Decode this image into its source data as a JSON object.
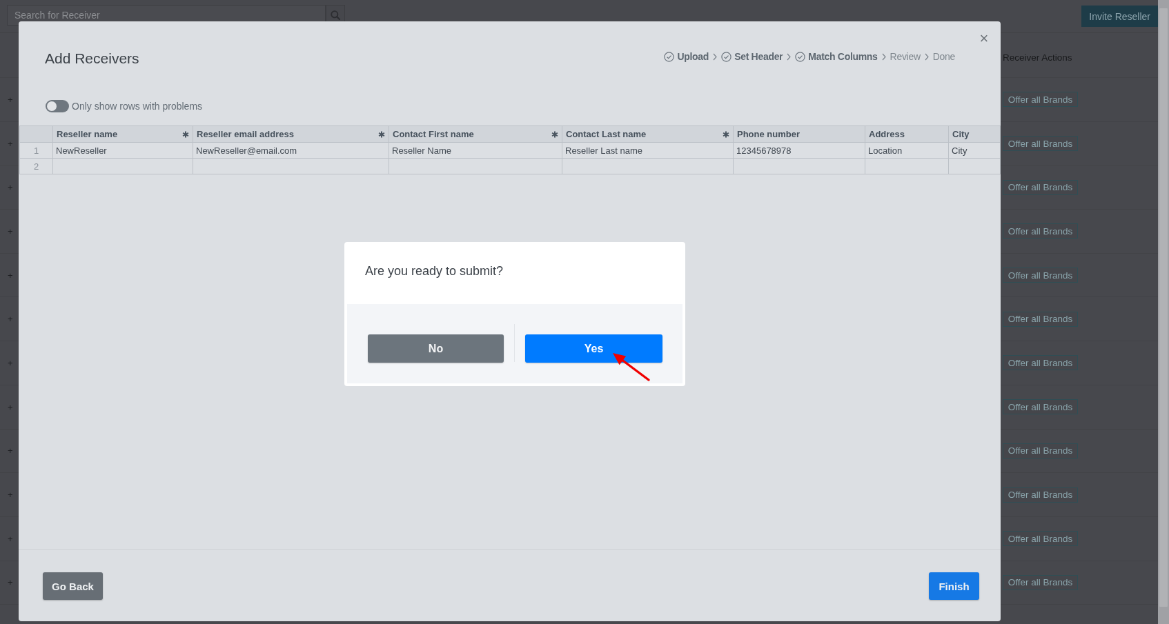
{
  "page": {
    "search": {
      "placeholder": "Search for Receiver"
    },
    "invite_button": "Invite Reseller",
    "actions_header": "Receiver Actions",
    "rows": [
      {
        "expand": "+",
        "action": "Offer all Brands"
      },
      {
        "expand": "+",
        "action": "Offer all Brands"
      },
      {
        "expand": "+",
        "action": "Offer all Brands"
      },
      {
        "expand": "+",
        "action": "Offer all Brands"
      },
      {
        "expand": "+",
        "action": "Offer all Brands"
      },
      {
        "expand": "+",
        "action": "Offer all Brands"
      },
      {
        "expand": "+",
        "action": "Offer all Brands"
      },
      {
        "expand": "+",
        "action": "Offer all Brands"
      },
      {
        "expand": "+",
        "action": "Offer all Brands"
      },
      {
        "expand": "+",
        "action": "Offer all Brands"
      },
      {
        "expand": "+",
        "action": "Offer all Brands"
      },
      {
        "expand": "+",
        "action": "Offer all Brands"
      }
    ]
  },
  "modal": {
    "title": "Add Receivers",
    "close": "×",
    "steps": [
      {
        "label": "Upload",
        "done": true
      },
      {
        "label": "Set Header",
        "done": true
      },
      {
        "label": "Match Columns",
        "done": true
      },
      {
        "label": "Review",
        "done": false
      },
      {
        "label": "Done",
        "done": false
      }
    ],
    "filter_toggle": {
      "label": "Only show rows with problems",
      "on": false
    },
    "table": {
      "columns": [
        {
          "label": "Reseller name",
          "required": true
        },
        {
          "label": "Reseller email address",
          "required": true
        },
        {
          "label": "Contact First name",
          "required": true
        },
        {
          "label": "Contact Last name",
          "required": true
        },
        {
          "label": "Phone number",
          "required": false
        },
        {
          "label": "Address",
          "required": false
        },
        {
          "label": "City",
          "required": false
        }
      ],
      "rows": [
        {
          "number": "1",
          "cells": [
            "NewReseller",
            "NewReseller@email.com",
            "Reseller Name",
            "Reseller Last name",
            "12345678978",
            "Location",
            "City"
          ]
        },
        {
          "number": "2"
        }
      ]
    },
    "back_button": "Go Back",
    "finish_button": "Finish"
  },
  "dialog": {
    "question": "Are you ready to submit?",
    "buttons": [
      {
        "label": "No",
        "kind": "secondary"
      },
      {
        "label": "Yes",
        "kind": "primary"
      }
    ]
  }
}
